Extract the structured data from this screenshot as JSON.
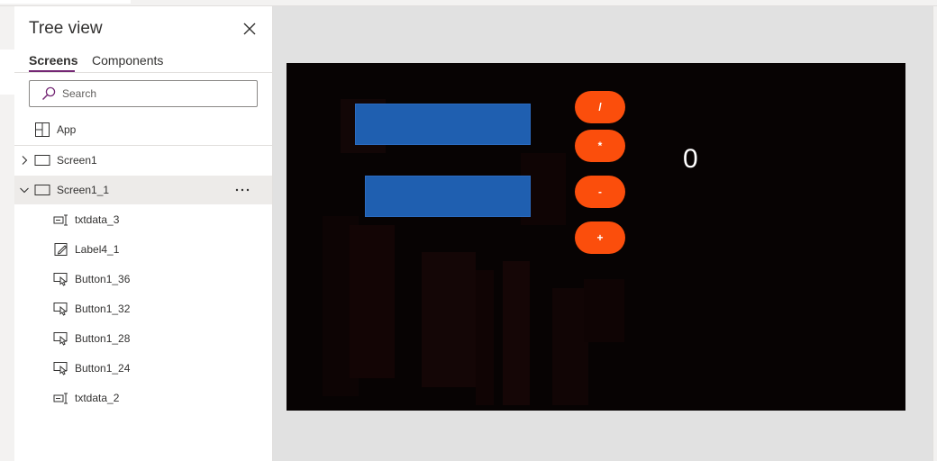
{
  "tree_view": {
    "title": "Tree view",
    "tabs": [
      {
        "label": "Screens",
        "active": true
      },
      {
        "label": "Components",
        "active": false
      }
    ],
    "search": {
      "placeholder": "Search",
      "value": ""
    },
    "items": [
      {
        "label": "App",
        "icon": "app-layout-icon"
      },
      {
        "label": "Screen1",
        "icon": "screen-icon",
        "expanded": false
      },
      {
        "label": "Screen1_1",
        "icon": "screen-icon",
        "expanded": true,
        "selected": true
      },
      {
        "label": "txtdata_3",
        "icon": "text-input-icon"
      },
      {
        "label": "Label4_1",
        "icon": "label-edit-icon"
      },
      {
        "label": "Button1_36",
        "icon": "button-icon"
      },
      {
        "label": "Button1_32",
        "icon": "button-icon"
      },
      {
        "label": "Button1_28",
        "icon": "button-icon"
      },
      {
        "label": "Button1_24",
        "icon": "button-icon"
      },
      {
        "label": "txtdata_2",
        "icon": "text-input-icon"
      }
    ]
  },
  "canvas": {
    "operator_buttons": [
      "/",
      "*",
      "-",
      "+"
    ],
    "result_label": "0",
    "colors": {
      "background": "#070303",
      "input_fill": "#1f5fb0",
      "button_fill": "#fb4e0c",
      "accent": "#742774"
    }
  }
}
